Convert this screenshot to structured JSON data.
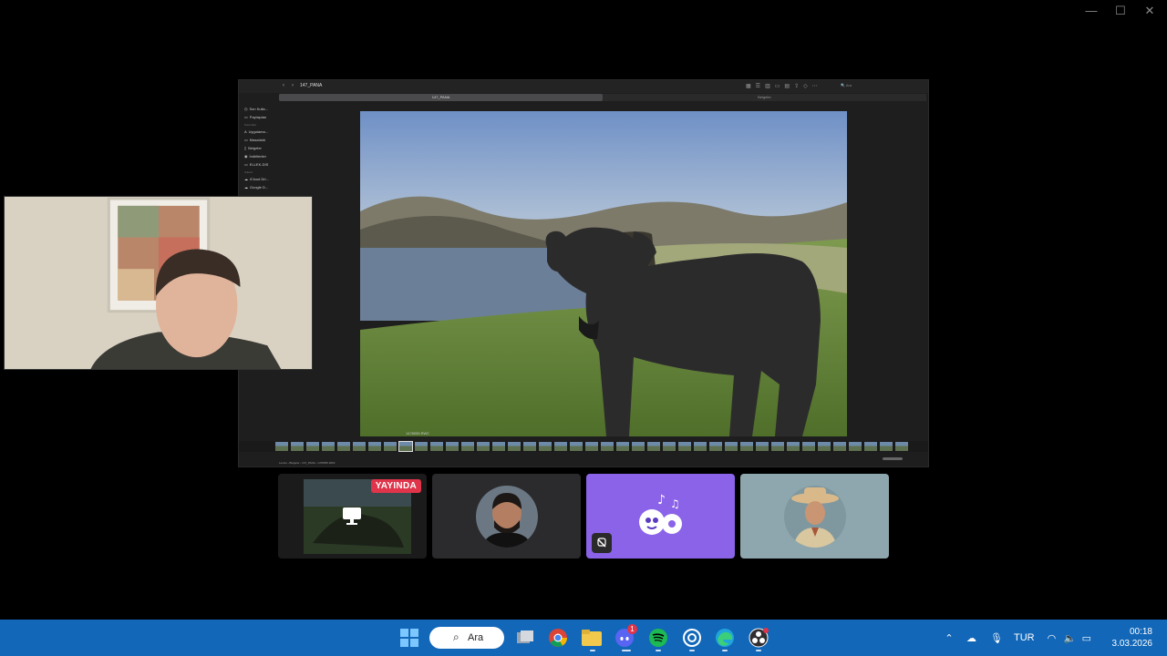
{
  "window_controls": {
    "minimize": "—",
    "maximize": "☐",
    "close": "✕"
  },
  "shared_screen": {
    "window_title": "147_PANA",
    "active_tab": "147_PANA",
    "second_tab": "Belgeler",
    "search_placeholder": "Ara",
    "sidebar": {
      "items_top": [
        "Son Kulla...",
        "Paylaşılan"
      ],
      "section_locations": "Konumlar",
      "items_locations": [
        "Uygulama...",
        "Masaüstü",
        "Belgeler",
        "İndirilenler",
        "ELLEK-DIS"
      ],
      "section_cloud": "iCloud",
      "items_cloud": [
        "iCloud Dri...",
        "Google D..."
      ]
    },
    "photo_caption": "1478055.RW2",
    "status_path": "Lensio › Belgeler › 147_PANA › 1478055.RW2",
    "filmstrip_count": 41
  },
  "tiles": {
    "screen": {
      "live_badge": "YAYINDA"
    },
    "person": {},
    "bot": {},
    "cowboy": {}
  },
  "taskbar": {
    "search_label": "Ara",
    "notification_badge": "1",
    "language": "TUR",
    "time": "00:18",
    "date": "3.03.2026"
  }
}
